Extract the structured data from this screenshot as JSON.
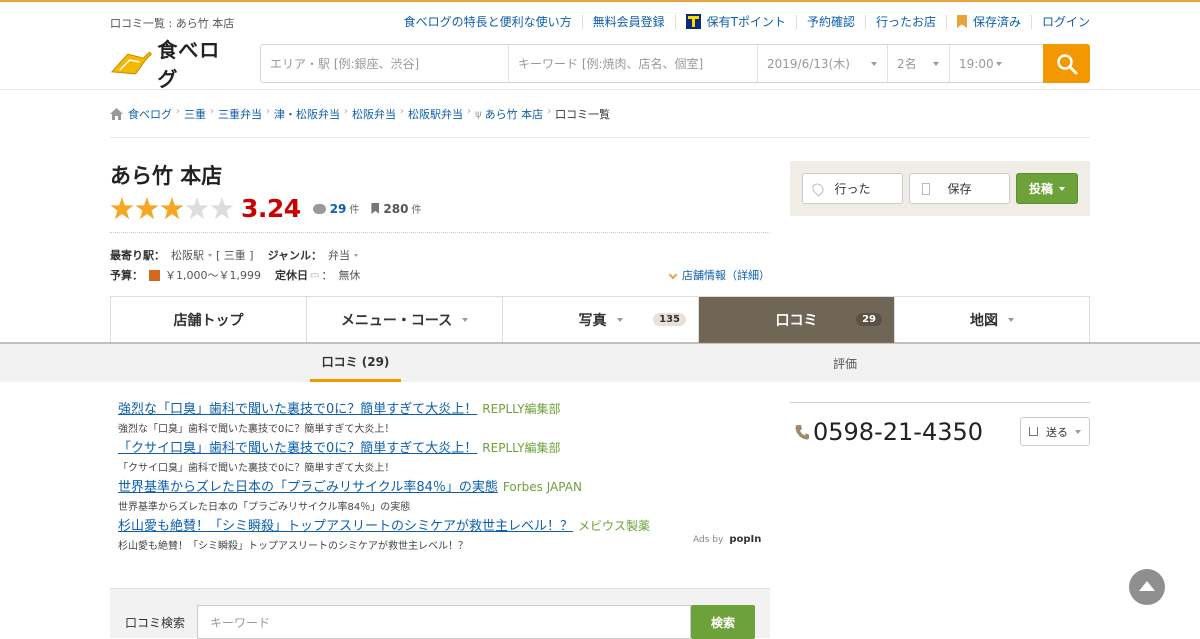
{
  "header": {
    "page_name": "口コミ一覧 : あら竹 本店",
    "links": [
      "食べログの特長と便利な使い方",
      "無料会員登録",
      "保有Tポイント",
      "予約確認",
      "行ったお店",
      "保存済み",
      "ログイン"
    ],
    "logo_text": "食べログ"
  },
  "search": {
    "area_placeholder": "エリア・駅 [例:銀座、渋谷]",
    "keyword_placeholder": "キーワード [例:焼肉、店名、個室]",
    "date": "2019/6/13(木)",
    "people": "2名",
    "time": "19:00"
  },
  "breadcrumb": [
    "食べログ",
    "三重",
    "三重弁当",
    "津・松阪弁当",
    "松阪弁当",
    "松阪駅弁当",
    "あら竹 本店",
    "口コミ一覧"
  ],
  "restaurant": {
    "name": "あら竹 本店",
    "score": "3.24",
    "rating_stars": 3,
    "reviews_count": "29",
    "saves_count": "280",
    "unit": "件",
    "station_label": "最寄り駅：",
    "station": "松阪駅",
    "prefecture": "[ 三重 ]",
    "genre_label": "ジャンル：",
    "genre": "弁当",
    "budget_label": "予算：",
    "budget": "￥1,000～￥1,999",
    "holiday_label": "定休日",
    "holiday": "無休",
    "info_link": "店舗情報（詳細）"
  },
  "actions": {
    "went": "行った",
    "save": "保存",
    "post": "投稿"
  },
  "tabs": [
    {
      "label": "店舗トップ",
      "count": ""
    },
    {
      "label": "メニュー・コース",
      "count": ""
    },
    {
      "label": "写真",
      "count": "135"
    },
    {
      "label": "口コミ",
      "count": "29"
    },
    {
      "label": "地図",
      "count": ""
    }
  ],
  "subtabs": {
    "reviews": "口コミ (29)",
    "ratings": "評価"
  },
  "ads": [
    {
      "title": "強烈な「口臭」歯科で聞いた裏技で0に？簡単すぎて大炎上！",
      "source": "REPLLY編集部",
      "desc": "強烈な「口臭」歯科で聞いた裏技で0に？簡単すぎて大炎上！"
    },
    {
      "title": "「クサイ口臭」歯科で聞いた裏技で0に？簡単すぎて大炎上！",
      "source": "REPLLY編集部",
      "desc": "「クサイ口臭」歯科で聞いた裏技で0に？簡単すぎて大炎上！"
    },
    {
      "title": "世界基準からズレた日本の「プラごみリサイクル率84％」の実態",
      "source": "Forbes JAPAN",
      "desc": "世界基準からズレた日本の「プラごみリサイクル率84％」の実態"
    },
    {
      "title": "杉山愛も絶賛！「シミ瞬殺」トップアスリートのシミケアが救世主レベル！？",
      "source": "メビウス製薬",
      "desc": "杉山愛も絶賛！「シミ瞬殺」トップアスリートのシミケアが救世主レベル！？"
    }
  ],
  "ads_by": {
    "label": "Ads by",
    "brand": "popIn"
  },
  "side": {
    "phone": "0598-21-4350",
    "send": "送る"
  },
  "review_search": {
    "label": "口コミ検索",
    "placeholder": "キーワード",
    "button": "検索"
  },
  "colors": {
    "accent": "#f39800",
    "score": "#cc0000",
    "link": "#0d5fae",
    "green": "#6da13a",
    "active_tab": "#6f6656"
  }
}
